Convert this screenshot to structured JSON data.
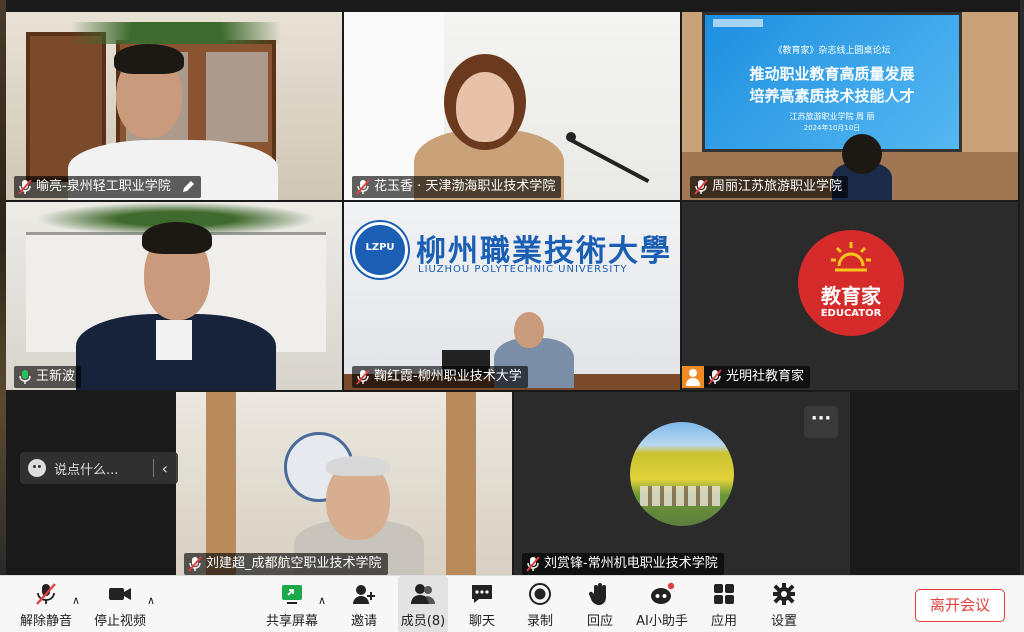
{
  "participants": [
    {
      "name": "喻亮-泉州轻工职业学院",
      "mic": "muted",
      "edit": true
    },
    {
      "name": "花玉香 · 天津渤海职业技术学院",
      "mic": "muted"
    },
    {
      "name": "周丽江苏旅游职业学院",
      "mic": "muted"
    },
    {
      "name": "王新波",
      "mic": "active",
      "active_speaker": true
    },
    {
      "name": "鞠红霞-柳州职业技术大学",
      "mic": "muted"
    },
    {
      "name": "光明社教育家",
      "mic": "muted",
      "avatar": "person-avatar-icon"
    },
    {
      "name": "刘建超_成都航空职业技术学院",
      "mic": "muted"
    },
    {
      "name": "刘赏锋-常州机电职业技术学院",
      "mic": "muted"
    }
  ],
  "presentation": {
    "subtitle": "《教育家》杂志线上圆桌论坛",
    "line1": "推动职业教育高质量发展",
    "line2": "培养高素质技术技能人才",
    "presenter": "江苏旅游职业学院  周  丽",
    "date": "2024年10月10日"
  },
  "banner": {
    "cn": "柳州職業技術大學",
    "en": "LIUZHOU POLYTECHNIC UNIVERSITY",
    "badge": "LZPU"
  },
  "educator_logo": {
    "cn": "教育家",
    "en": "EDUCATOR",
    "color": "#d62b2b"
  },
  "chat_input": {
    "placeholder": "说点什么...",
    "collapse": "‹"
  },
  "more_button": "···",
  "toolbar": {
    "unmute": "解除静音",
    "stop_video": "停止视频",
    "share": "共享屏幕",
    "invite": "邀请",
    "members": "成员(8)",
    "chat": "聊天",
    "record": "录制",
    "react": "回应",
    "ai": "AI小助手",
    "apps": "应用",
    "settings": "设置",
    "leave": "离开会议"
  },
  "colors": {
    "active_border": "#23c15a",
    "muted_red": "#e0413f",
    "leave_red": "#e0413f"
  }
}
